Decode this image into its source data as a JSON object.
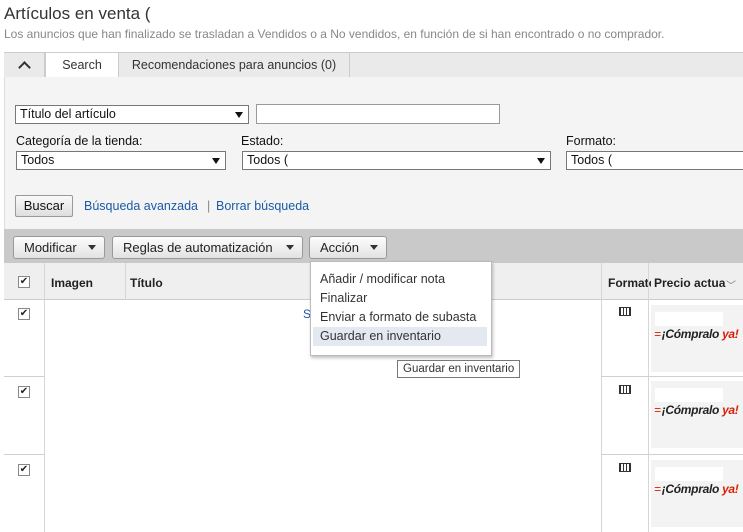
{
  "page": {
    "title": "Artículos en venta (",
    "subtitle": "Los anuncios que han finalizado se trasladan a Vendidos o a No vendidos, en función de si han encontrado o no comprador."
  },
  "tabs": {
    "search": "Search",
    "recommendations": "Recomendaciones para anuncios (0)"
  },
  "filters": {
    "search_field_select": "Título del artículo",
    "search_text_value": "",
    "category_label": "Categoría de la tienda:",
    "category_value": "Todos",
    "status_label": "Estado:",
    "status_value": "Todos (",
    "format_label": "Formato:",
    "format_value": "Todos (",
    "search_button": "Buscar",
    "advanced_search_link": "Búsqueda avanzada",
    "separator": "|",
    "clear_search_link": "Borrar búsqueda"
  },
  "actions": {
    "modify": "Modificar",
    "automation_rules": "Reglas de automatización",
    "action": "Acción"
  },
  "action_menu": {
    "items": [
      "Añadir / modificar nota",
      "Finalizar",
      "Enviar a formato de subasta",
      "Guardar en inventario"
    ],
    "highlighted_index": 3
  },
  "tooltip": "Guardar en inventario",
  "table": {
    "columns": {
      "image": "Imagen",
      "title": "Título",
      "format": "Formato",
      "price": "Precio actual"
    },
    "rows": [
      {
        "checked": true,
        "title_link": "S",
        "format_icon": "buy-it-now-icon",
        "badge_main": "¡Cómpralo ",
        "badge_accent": "ya!"
      },
      {
        "checked": true,
        "title_link": "",
        "format_icon": "buy-it-now-icon",
        "badge_main": "¡Cómpralo ",
        "badge_accent": "ya!"
      },
      {
        "checked": true,
        "title_link": "",
        "format_icon": "buy-it-now-icon",
        "badge_main": "¡Cómpralo ",
        "badge_accent": "ya!"
      }
    ]
  },
  "colors": {
    "link": "#1a5aa8",
    "accent_red": "#d81e05",
    "action_bar": "#c9c9c9",
    "menu_highlight": "#e4e8f1"
  }
}
